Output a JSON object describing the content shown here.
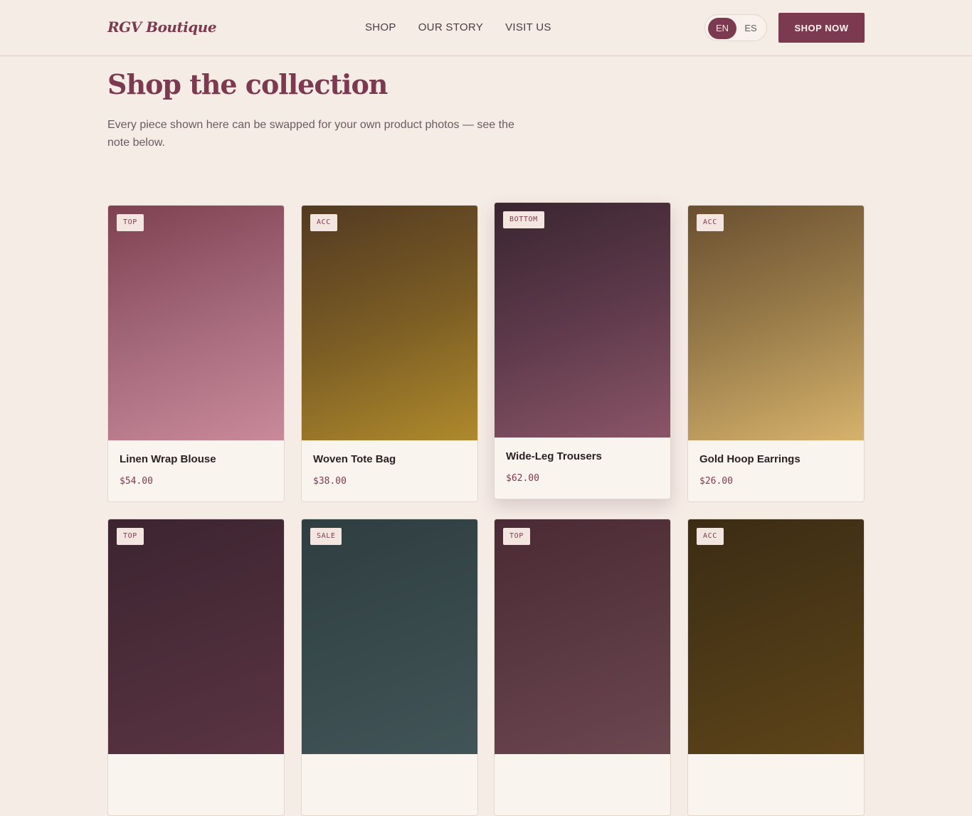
{
  "brand": "RGV Boutique",
  "nav": [
    "SHOP",
    "OUR STORY",
    "VISIT US"
  ],
  "language": {
    "active": "EN",
    "other": "ES"
  },
  "cta": "SHOP NOW",
  "hero": {
    "title": "Shop the collection",
    "subtitle": "Every piece shown here can be swapped for your own product photos — see the note below."
  },
  "products": [
    {
      "tag": "TOP",
      "name": "Linen Wrap Blouse",
      "price": "$54.00"
    },
    {
      "tag": "ACC",
      "name": "Woven Tote Bag",
      "price": "$38.00"
    },
    {
      "tag": "BOTTOM",
      "name": "Wide-Leg Trousers",
      "price": "$62.00"
    },
    {
      "tag": "ACC",
      "name": "Gold Hoop Earrings",
      "price": "$26.00"
    },
    {
      "tag": "TOP",
      "name": "",
      "price": ""
    },
    {
      "tag": "SALE",
      "name": "",
      "price": ""
    },
    {
      "tag": "TOP",
      "name": "",
      "price": ""
    },
    {
      "tag": "ACC",
      "name": "",
      "price": ""
    }
  ],
  "colors": {
    "accent": "#7b3a4f",
    "background": "#f6ece6"
  }
}
